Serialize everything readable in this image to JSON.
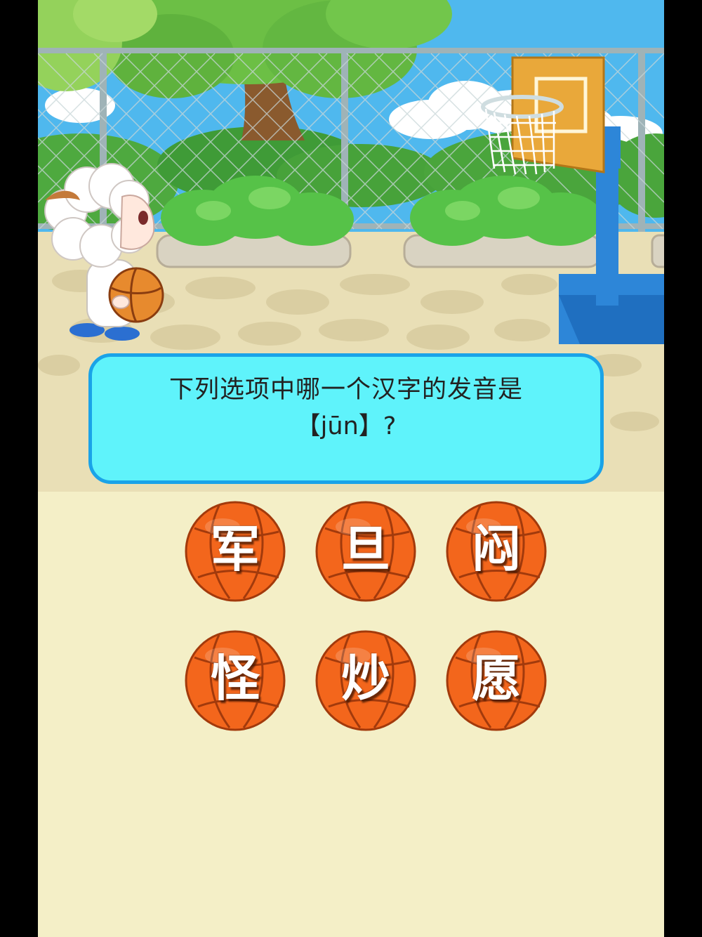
{
  "question": {
    "line1": "下列选项中哪一个汉字的发音是",
    "line2": "【jūn】?"
  },
  "answers": [
    "军",
    "旦",
    "闷",
    "怪",
    "炒",
    "愿"
  ],
  "colors": {
    "sky": "#4fb8ee",
    "ground": "#f4efc7",
    "question_bg": "#5ff3fb",
    "question_border": "#1aa3e8",
    "ball": "#f3661c",
    "hoop_pole": "#2d86d8"
  },
  "icons": {
    "character": "sheep-player-icon",
    "hoop": "basketball-hoop-icon",
    "ball": "basketball-icon"
  }
}
